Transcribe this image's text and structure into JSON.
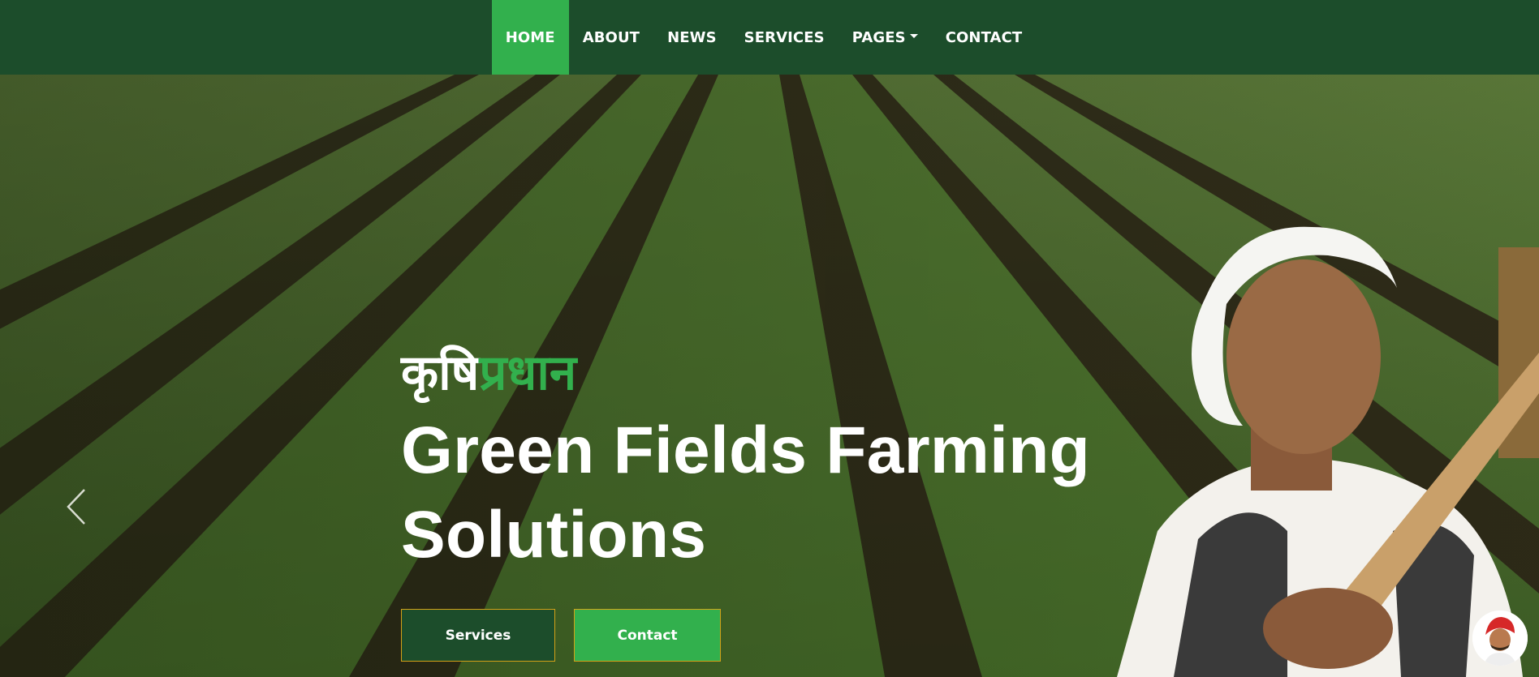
{
  "nav": {
    "items": [
      {
        "label": "HOME"
      },
      {
        "label": "ABOUT"
      },
      {
        "label": "NEWS"
      },
      {
        "label": "SERVICES"
      },
      {
        "label": "PAGES"
      },
      {
        "label": "CONTACT"
      }
    ],
    "active": "HOME"
  },
  "hero": {
    "tagline_white": "कृषि",
    "tagline_green": "प्रधान",
    "headline_line1": "Green Fields Farming",
    "headline_line2": "Solutions",
    "buttons": {
      "services": "Services",
      "contact": "Contact"
    }
  },
  "icons": {
    "prev": "chevron-left-icon",
    "avatar": "farmer-avatar-icon",
    "dropdown": "caret-down-icon"
  },
  "colors": {
    "nav_bg": "#1c4d2b",
    "accent": "#32b04d",
    "button_border": "#d4a017"
  }
}
